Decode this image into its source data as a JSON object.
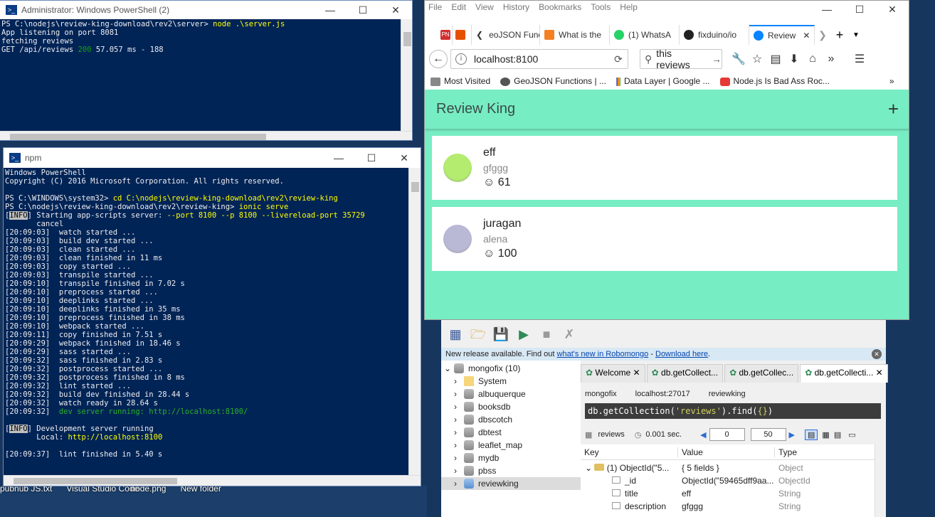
{
  "desktop_icons": [
    "pubnub JS.txt",
    "Visual Studio Code",
    "node.png",
    "New folder"
  ],
  "ps1": {
    "title": "Administrator: Windows PowerShell (2)",
    "lines": [
      {
        "prompt": "PS C:\\nodejs\\review-king-download\\rev2\\server> ",
        "cmd": "node .\\server.js"
      },
      {
        "text": "App listening on port 8081"
      },
      {
        "text": "fetching reviews"
      },
      {
        "pre": "GET /api/reviews ",
        "status": "200",
        "post": " 57.057 ms - 188"
      }
    ]
  },
  "npm": {
    "title": "npm",
    "header": [
      "Windows PowerShell",
      "Copyright (C) 2016 Microsoft Corporation. All rights reserved."
    ],
    "cmd1_prompt": "PS C:\\WINDOWS\\system32> ",
    "cmd1": "cd C:\\nodejs\\review-king-download\\rev2\\review-king",
    "cmd2_prompt": "PS C:\\nodejs\\review-king-download\\rev2\\review-king> ",
    "cmd2": "ionic serve",
    "info_tag": "INFO",
    "start_text": " Starting app-scripts server: ",
    "start_args": "--port 8100 --p 8100 --livereload-port 35729",
    "cancel": "       cancel",
    "log": [
      "[20:09:03]  watch started ...",
      "[20:09:03]  build dev started ...",
      "[20:09:03]  clean started ...",
      "[20:09:03]  clean finished in 11 ms",
      "[20:09:03]  copy started ...",
      "[20:09:03]  transpile started ...",
      "[20:09:10]  transpile finished in 7.02 s",
      "[20:09:10]  preprocess started ...",
      "[20:09:10]  deeplinks started ...",
      "[20:09:10]  deeplinks finished in 35 ms",
      "[20:09:10]  preprocess finished in 38 ms",
      "[20:09:10]  webpack started ...",
      "[20:09:11]  copy finished in 7.51 s",
      "[20:09:29]  webpack finished in 18.46 s",
      "[20:09:29]  sass started ...",
      "[20:09:32]  sass finished in 2.83 s",
      "[20:09:32]  postprocess started ...",
      "[20:09:32]  postprocess finished in 8 ms",
      "[20:09:32]  lint started ...",
      "[20:09:32]  build dev finished in 28.44 s",
      "[20:09:32]  watch ready in 28.64 s"
    ],
    "dev_time": "[20:09:32]",
    "dev_text": "  dev server running: http://localhost:8100/",
    "dev_info": " Development server running",
    "local_label": "       Local: ",
    "local_url": "http://localhost:8100",
    "lint_done": "[20:09:37]  lint finished in 5.40 s"
  },
  "firefox": {
    "menu": [
      "File",
      "Edit",
      "View",
      "History",
      "Bookmarks",
      "Tools",
      "Help"
    ],
    "tabs": [
      {
        "label": "PN",
        "color": "#d32f2f"
      },
      {
        "label": "",
        "color": "#e65100"
      },
      {
        "label": "eoJSON Funct",
        "color": "#ffffff"
      },
      {
        "label": "What is the",
        "color": "#f48024"
      },
      {
        "label": "(1) WhatsA",
        "color": "#25d366"
      },
      {
        "label": "fixduino/io",
        "color": "#222222"
      },
      {
        "label": "Review",
        "color": "#0a84ff"
      }
    ],
    "url": "localhost:8100",
    "search": "this reviews",
    "bookmarks": [
      "Most Visited",
      "GeoJSON Functions | ...",
      "Data Layer  |  Google ...",
      "Node.js Is Bad Ass Roc..."
    ]
  },
  "app": {
    "title": "Review King",
    "reviews": [
      {
        "title": "eff",
        "description": "gfggg",
        "score": "61",
        "avatar": "#b4ec6f"
      },
      {
        "title": "juragan",
        "description": "alena",
        "score": "100",
        "avatar": "#b9b9d6"
      }
    ]
  },
  "robomongo": {
    "notice_pre": "New release available. Find out ",
    "notice_link1": "what's new in Robomongo",
    "notice_mid": " - ",
    "notice_link2": "Download here",
    "notice_end": ".",
    "tree_root": "mongofix (10)",
    "tree": [
      "System",
      "albuquerque",
      "booksdb",
      "dbscotch",
      "dbtest",
      "leaflet_map",
      "mydb",
      "pbss",
      "reviewking"
    ],
    "tabs": [
      "Welcome",
      "db.getCollect...",
      "db.getCollec...",
      "db.getCollecti..."
    ],
    "conn": [
      "mongofix",
      "localhost:27017",
      "reviewking"
    ],
    "query_pre": "db.getCollection(",
    "query_arg": "'reviews'",
    "query_post": ").find(",
    "query_obj": "{}",
    "query_end": ")",
    "collection": "reviews",
    "time": "0.001 sec.",
    "page_from": "0",
    "page_size": "50",
    "cols": [
      "Key",
      "Value",
      "Type"
    ],
    "rows": [
      {
        "key": "(1) ObjectId(\"5...",
        "value": "{ 5 fields }",
        "type": "Object"
      },
      {
        "key": "_id",
        "value": "ObjectId(\"59465dff9aa...",
        "type": "ObjectId"
      },
      {
        "key": "title",
        "value": "eff",
        "type": "String"
      },
      {
        "key": "description",
        "value": "gfggg",
        "type": "String"
      }
    ]
  }
}
